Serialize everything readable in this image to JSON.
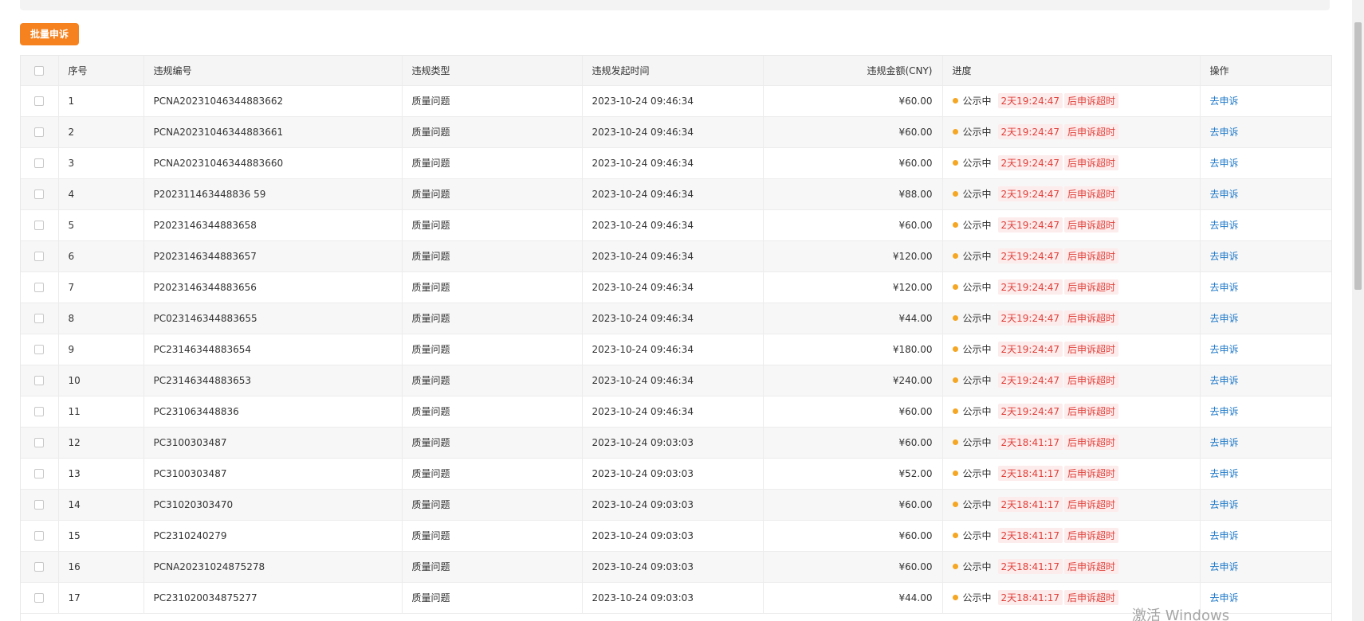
{
  "toolbar": {
    "batch_appeal_label": "批量申诉"
  },
  "table": {
    "columns": [
      "序号",
      "违规编号",
      "违规类型",
      "违规发起时间",
      "违规金额(CNY)",
      "进度",
      "操作"
    ],
    "rows": [
      {
        "no": "1",
        "code": "PCNA20231046344883662",
        "type": "质量问题",
        "time": "2023-10-24 09:46:34",
        "amount": "¥60.00",
        "status": "公示中",
        "countdown": "2天19:24:47",
        "tag": "后申诉超时",
        "action": "去申诉"
      },
      {
        "no": "2",
        "code": "PCNA20231046344883661",
        "type": "质量问题",
        "time": "2023-10-24 09:46:34",
        "amount": "¥60.00",
        "status": "公示中",
        "countdown": "2天19:24:47",
        "tag": "后申诉超时",
        "action": "去申诉"
      },
      {
        "no": "3",
        "code": "PCNA20231046344883660",
        "type": "质量问题",
        "time": "2023-10-24 09:46:34",
        "amount": "¥60.00",
        "status": "公示中",
        "countdown": "2天19:24:47",
        "tag": "后申诉超时",
        "action": "去申诉"
      },
      {
        "no": "4",
        "code": "P202311463448836 59",
        "type": "质量问题",
        "time": "2023-10-24 09:46:34",
        "amount": "¥88.00",
        "status": "公示中",
        "countdown": "2天19:24:47",
        "tag": "后申诉超时",
        "action": "去申诉"
      },
      {
        "no": "5",
        "code": "P2023146344883658",
        "type": "质量问题",
        "time": "2023-10-24 09:46:34",
        "amount": "¥60.00",
        "status": "公示中",
        "countdown": "2天19:24:47",
        "tag": "后申诉超时",
        "action": "去申诉"
      },
      {
        "no": "6",
        "code": "P2023146344883657",
        "type": "质量问题",
        "time": "2023-10-24 09:46:34",
        "amount": "¥120.00",
        "status": "公示中",
        "countdown": "2天19:24:47",
        "tag": "后申诉超时",
        "action": "去申诉"
      },
      {
        "no": "7",
        "code": "P2023146344883656",
        "type": "质量问题",
        "time": "2023-10-24 09:46:34",
        "amount": "¥120.00",
        "status": "公示中",
        "countdown": "2天19:24:47",
        "tag": "后申诉超时",
        "action": "去申诉"
      },
      {
        "no": "8",
        "code": "PC023146344883655",
        "type": "质量问题",
        "time": "2023-10-24 09:46:34",
        "amount": "¥44.00",
        "status": "公示中",
        "countdown": "2天19:24:47",
        "tag": "后申诉超时",
        "action": "去申诉"
      },
      {
        "no": "9",
        "code": "PC23146344883654",
        "type": "质量问题",
        "time": "2023-10-24 09:46:34",
        "amount": "¥180.00",
        "status": "公示中",
        "countdown": "2天19:24:47",
        "tag": "后申诉超时",
        "action": "去申诉"
      },
      {
        "no": "10",
        "code": "PC23146344883653",
        "type": "质量问题",
        "time": "2023-10-24 09:46:34",
        "amount": "¥240.00",
        "status": "公示中",
        "countdown": "2天19:24:47",
        "tag": "后申诉超时",
        "action": "去申诉"
      },
      {
        "no": "11",
        "code": "PC231063448836",
        "type": "质量问题",
        "time": "2023-10-24 09:46:34",
        "amount": "¥60.00",
        "status": "公示中",
        "countdown": "2天19:24:47",
        "tag": "后申诉超时",
        "action": "去申诉"
      },
      {
        "no": "12",
        "code": "PC3100303487",
        "type": "质量问题",
        "time": "2023-10-24 09:03:03",
        "amount": "¥60.00",
        "status": "公示中",
        "countdown": "2天18:41:17",
        "tag": "后申诉超时",
        "action": "去申诉"
      },
      {
        "no": "13",
        "code": "PC3100303487",
        "type": "质量问题",
        "time": "2023-10-24 09:03:03",
        "amount": "¥52.00",
        "status": "公示中",
        "countdown": "2天18:41:17",
        "tag": "后申诉超时",
        "action": "去申诉"
      },
      {
        "no": "14",
        "code": "PC31020303470",
        "type": "质量问题",
        "time": "2023-10-24 09:03:03",
        "amount": "¥60.00",
        "status": "公示中",
        "countdown": "2天18:41:17",
        "tag": "后申诉超时",
        "action": "去申诉"
      },
      {
        "no": "15",
        "code": "PC2310240279",
        "type": "质量问题",
        "time": "2023-10-24 09:03:03",
        "amount": "¥60.00",
        "status": "公示中",
        "countdown": "2天18:41:17",
        "tag": "后申诉超时",
        "action": "去申诉"
      },
      {
        "no": "16",
        "code": "PCNA20231024875278",
        "type": "质量问题",
        "time": "2023-10-24 09:03:03",
        "amount": "¥60.00",
        "status": "公示中",
        "countdown": "2天18:41:17",
        "tag": "后申诉超时",
        "action": "去申诉"
      },
      {
        "no": "17",
        "code": "PC231020034875277",
        "type": "质量问题",
        "time": "2023-10-24 09:03:03",
        "amount": "¥44.00",
        "status": "公示中",
        "countdown": "2天18:41:17",
        "tag": "后申诉超时",
        "action": "去申诉"
      }
    ]
  },
  "watermark": {
    "activate_text": "激活 Windows"
  },
  "colors": {
    "accent": "#f5821f",
    "link": "#1f79c9",
    "status_dot": "#f5a623",
    "tag_text": "#e0403a",
    "tag_bg": "#fdecec"
  }
}
